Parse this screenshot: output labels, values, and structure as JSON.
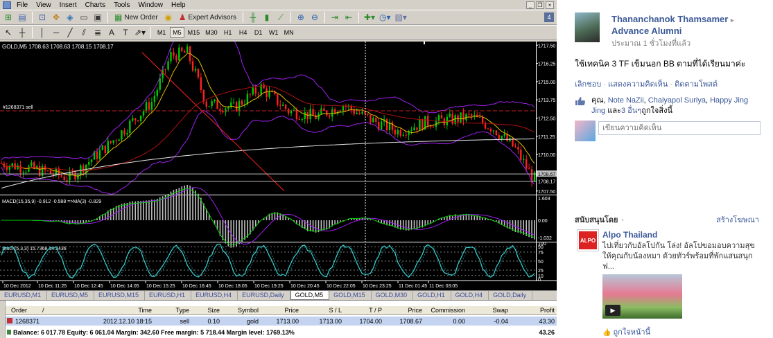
{
  "menu": {
    "items": [
      "File",
      "View",
      "Insert",
      "Charts",
      "Tools",
      "Window",
      "Help"
    ]
  },
  "toolbar": {
    "new_order": "New Order",
    "expert_advisors": "Expert Advisors",
    "badge": "4"
  },
  "timeframes": [
    "M1",
    "M5",
    "M15",
    "M30",
    "H1",
    "H4",
    "D1",
    "W1",
    "MN"
  ],
  "active_timeframe": "M5",
  "chart": {
    "header": "GOLD,M5  1708.63 1708.63 1708.15 1708.17",
    "order_label": "#1268371 sell",
    "macd_label": "MACD(15,35,9) -0.912 -0.588  =>MA(3) -0.829",
    "stoch_label": "Stoch(5,3,3) 15.7368 14.3436",
    "price_axis": [
      "1717.50",
      "1716.25",
      "1715.00",
      "1713.75",
      "1712.50",
      "1711.25",
      "1710.00",
      "1708.67",
      "1708.17",
      "1707.50"
    ],
    "macd_axis": [
      "1.603",
      "0.00",
      "-1.032"
    ],
    "stoch_axis": [
      "100",
      "90",
      "75",
      "50",
      "25",
      "10",
      "0"
    ],
    "time_axis": [
      "10 Dec 2012",
      "10 Dec 11:25",
      "10 Dec 12:45",
      "10 Dec 14:05",
      "10 Dec 15:25",
      "10 Dec 16:45",
      "10 Dec 18:05",
      "10 Dec 19:25",
      "10 Dec 20:45",
      "10 Dec 22:05",
      "10 Dec 23:25",
      "11 Dec 01:45",
      "11 Dec 03:05"
    ]
  },
  "symbol_tabs": [
    "EURUSD,M1",
    "EURUSD,M5",
    "EURUSD,M15",
    "EURUSD,H1",
    "EURUSD,H4",
    "EURUSD,Daily",
    "GOLD,M5",
    "GOLD,M15",
    "GOLD,M30",
    "GOLD,H1",
    "GOLD,H4",
    "GOLD,Daily"
  ],
  "active_symbol_tab": "GOLD,M5",
  "terminal": {
    "columns": [
      "Order",
      "/",
      "Time",
      "Type",
      "Size",
      "Symbol",
      "Price",
      "S / L",
      "T / P",
      "Price",
      "Commission",
      "Swap",
      "Profit"
    ],
    "order": {
      "ticket": "1268371",
      "time": "2012.12.10 18:15",
      "type": "sell",
      "size": "0.10",
      "symbol": "gold",
      "price": "1713.00",
      "sl": "1713.00",
      "tp": "1704.00",
      "current_price": "1708.67",
      "commission": "0.00",
      "swap": "-0.04",
      "profit": "43.30"
    },
    "balance_line": "Balance: 6 017.78  Equity: 6 061.04  Margin: 342.60  Free margin: 5 718.44  Margin level: 1769.13%",
    "total_profit": "43.26"
  },
  "fb": {
    "author": "Thananchanok Thamsamer",
    "network": "Advance Alumni",
    "time": "ประมาณ 1 ชั่วโมงที่แล้ว",
    "status": "ใช้เทคนิค 3 TF เข็มนอก BB ตามที่ได้เรียนมาค่ะ",
    "actions": [
      "เลิกชอบ",
      "แสดงความคิดเห็น",
      "ติดตามโพสต์"
    ],
    "likes_prefix": "คุณ,",
    "likers": [
      "Note NaZii",
      "Chaiyapol Suriya",
      "Happy Jing Jing"
    ],
    "likes_and": "และ",
    "likes_others": "3 อื่นๆ",
    "likes_suffix": "ถูกใจสิ่งนี้",
    "comment_placeholder": "เขียนความคิดเห็น",
    "sponsored_title": "สนับสนุนโดย",
    "create_ad": "สร้างโฆษณา",
    "ad_name": "Alpo Thailand",
    "ad_logo_text": "ALPO",
    "ad_text": "ไปเที่ยวกับอัลโปกัน โล่ง! อัลโปขอมอบความสุขให้คุณกับน้องหมา ด้วยทัวร์พร้อมที่พักแสนสนุก ฟ...",
    "ad_like": "ถูกใจหน้านี้"
  },
  "colors": {
    "bull_candle": "#00c800",
    "bear_candle": "#ff2020",
    "bollinger": "#a020f0",
    "ma_fast": "#e0c000",
    "ma_slow": "#b01010",
    "ma_long": "#e8e8e8",
    "macd_hist": "#c0c0c0",
    "stoch_main": "#35c9c9",
    "fb_blue": "#3b5998"
  }
}
